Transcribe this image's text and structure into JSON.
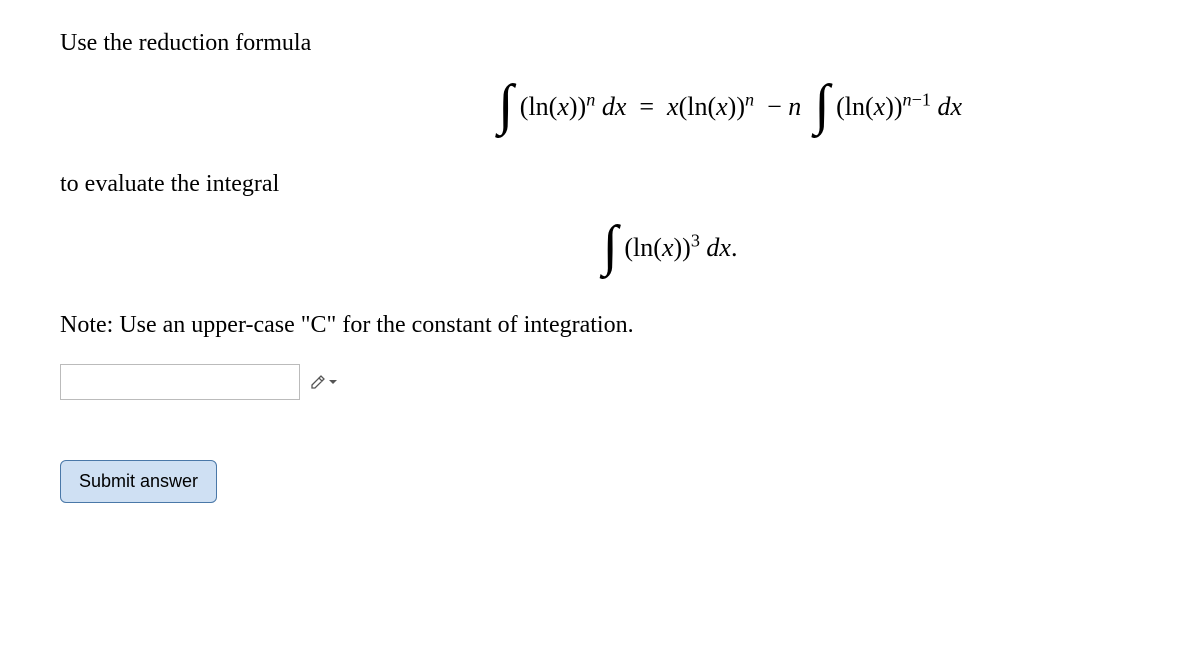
{
  "problem": {
    "line1": "Use the reduction formula",
    "formula_latex": "\\int (\\ln(x))^{n}\\,dx = x(\\ln(x))^{n} - n\\int (\\ln(x))^{n-1}\\,dx",
    "line2": "to evaluate the integral",
    "integral_latex": "\\int (\\ln(x))^{3}\\,dx.",
    "note": "Note: Use an upper-case \"C\" for the constant of integration."
  },
  "input": {
    "value": "",
    "placeholder": ""
  },
  "buttons": {
    "submit": "Submit answer"
  },
  "icons": {
    "edit": "pencil-dropdown"
  }
}
